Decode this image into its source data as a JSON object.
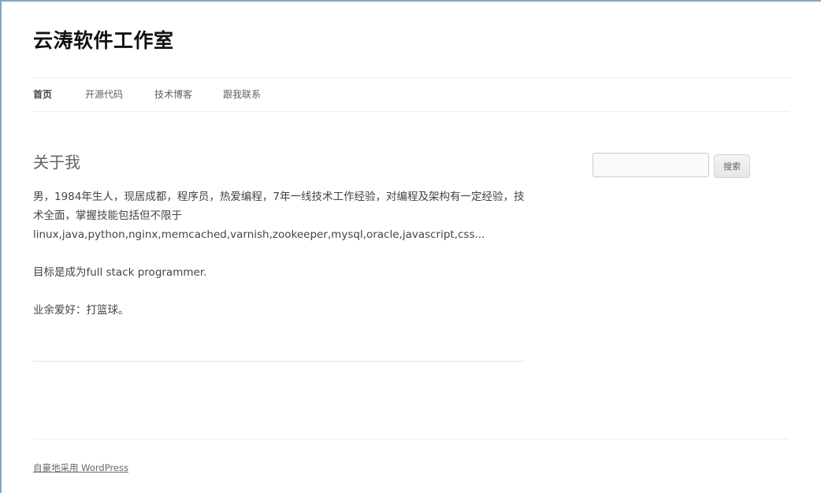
{
  "site": {
    "title": "云涛软件工作室"
  },
  "nav": {
    "items": [
      {
        "label": "首页",
        "current": true
      },
      {
        "label": "开源代码",
        "current": false
      },
      {
        "label": "技术博客",
        "current": false
      },
      {
        "label": "跟我联系",
        "current": false
      }
    ]
  },
  "entry": {
    "title": "关于我",
    "paragraphs": [
      "男，1984年生人，现居成都，程序员，热爱编程，7年一线技术工作经验，对编程及架构有一定经验，技术全面，掌握技能包括但不限于linux,java,python,nginx,memcached,varnish,zookeeper,mysql,oracle,javascript,css...",
      "目标是成为full stack programmer.",
      "业余爱好：打篮球。"
    ]
  },
  "search": {
    "value": "",
    "button_label": "搜索"
  },
  "footer": {
    "credit_link": "自豪地采用 WordPress"
  },
  "colors": {
    "window_frame": "#8aa4bd",
    "divider": "#ededed",
    "text": "#444444"
  }
}
